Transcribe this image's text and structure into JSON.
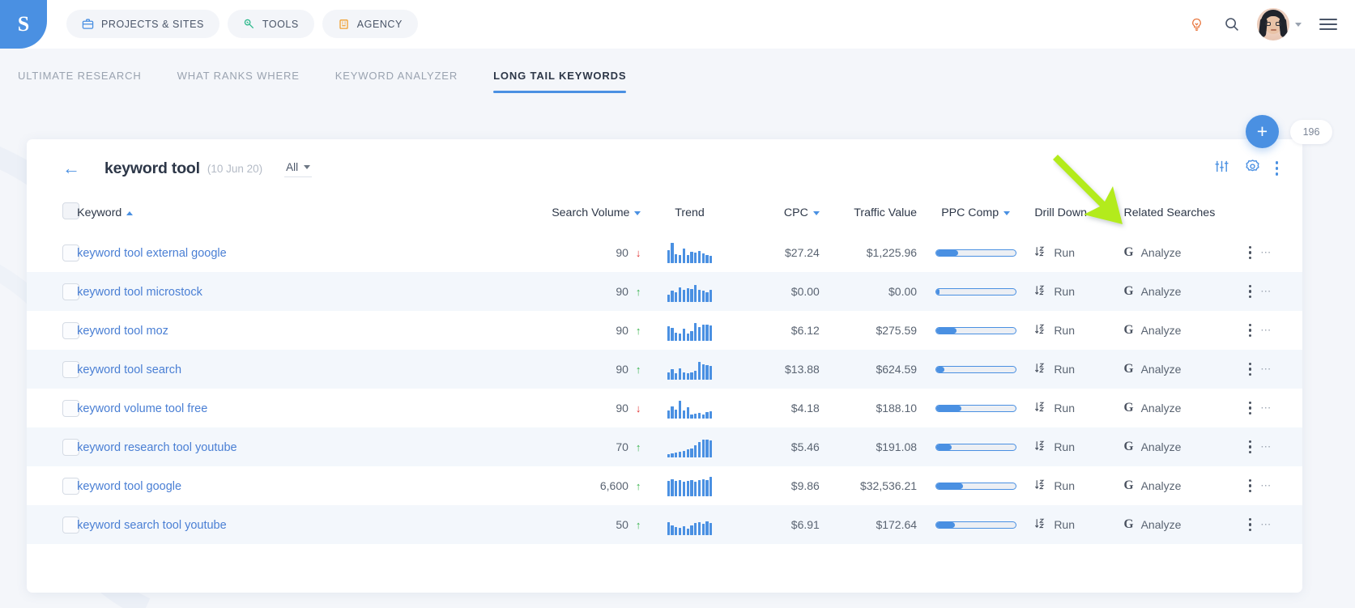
{
  "brand": {
    "logo_glyph": "S",
    "accent": "#4a90e2"
  },
  "topnav": {
    "pills": [
      {
        "label": "PROJECTS & SITES",
        "icon": "briefcase-icon",
        "color": "#4a90e2"
      },
      {
        "label": "TOOLS",
        "icon": "wrench-icon",
        "color": "#2fb98d"
      },
      {
        "label": "AGENCY",
        "icon": "building-icon",
        "color": "#f0a030"
      }
    ],
    "icons": [
      {
        "name": "lightbulb-icon",
        "color": "#e8743b"
      },
      {
        "name": "search-icon",
        "color": "#4a5568"
      }
    ],
    "avatar_alt": "user-avatar",
    "menu_icon": "hamburger-menu-icon"
  },
  "tabs": [
    {
      "label": "ULTIMATE RESEARCH",
      "active": false
    },
    {
      "label": "WHAT RANKS WHERE",
      "active": false
    },
    {
      "label": "KEYWORD ANALYZER",
      "active": false
    },
    {
      "label": "LONG TAIL KEYWORDS",
      "active": true
    }
  ],
  "fab": {
    "plus_label": "+",
    "count_label": "196"
  },
  "card": {
    "back_icon": "back-arrow-icon",
    "title": "keyword tool",
    "date": "(10 Jun 20)",
    "filter_select": "All",
    "head_icons": [
      {
        "name": "sliders-filter-icon"
      },
      {
        "name": "gear-settings-icon"
      },
      {
        "name": "more-vertical-icon"
      }
    ]
  },
  "table": {
    "columns": [
      {
        "key": "checkbox",
        "label": "",
        "sort": null
      },
      {
        "key": "keyword",
        "label": "Keyword",
        "sort": "asc"
      },
      {
        "key": "search_volume",
        "label": "Search Volume",
        "sort": "desc"
      },
      {
        "key": "trend",
        "label": "Trend",
        "sort": null
      },
      {
        "key": "cpc",
        "label": "CPC",
        "sort": "desc"
      },
      {
        "key": "traffic_value",
        "label": "Traffic Value",
        "sort": null
      },
      {
        "key": "ppc_comp",
        "label": "PPC Comp",
        "sort": "desc"
      },
      {
        "key": "drill_down",
        "label": "Drill Down",
        "sort": null
      },
      {
        "key": "related_searches",
        "label": "Related Searches",
        "sort": null
      },
      {
        "key": "actions",
        "label": "",
        "sort": null
      }
    ],
    "action_labels": {
      "drill_down": "Run",
      "related": "Analyze",
      "google_mark": "G"
    },
    "rows": [
      {
        "keyword": "keyword tool external google",
        "search_volume": "90",
        "trend_dir": "down",
        "sparkline": [
          62,
          96,
          44,
          38,
          70,
          40,
          52,
          50,
          56,
          48,
          40,
          36
        ],
        "cpc": "$27.24",
        "traffic_value": "$1,225.96",
        "ppc_comp": 28,
        "drill_down": "Run",
        "related": "Analyze"
      },
      {
        "keyword": "keyword tool microstock",
        "search_volume": "90",
        "trend_dir": "up",
        "sparkline": [
          34,
          52,
          48,
          70,
          58,
          66,
          62,
          82,
          58,
          54,
          46,
          56
        ],
        "cpc": "$0.00",
        "traffic_value": "$0.00",
        "ppc_comp": 4,
        "drill_down": "Run",
        "related": "Analyze"
      },
      {
        "keyword": "keyword tool moz",
        "search_volume": "90",
        "trend_dir": "up",
        "sparkline": [
          70,
          62,
          40,
          34,
          58,
          36,
          48,
          86,
          66,
          76,
          78,
          72
        ],
        "cpc": "$6.12",
        "traffic_value": "$275.59",
        "ppc_comp": 26,
        "drill_down": "Run",
        "related": "Analyze"
      },
      {
        "keyword": "keyword tool search",
        "search_volume": "90",
        "trend_dir": "up",
        "sparkline": [
          36,
          50,
          30,
          54,
          36,
          30,
          34,
          44,
          84,
          74,
          70,
          66
        ],
        "cpc": "$13.88",
        "traffic_value": "$624.59",
        "ppc_comp": 11,
        "drill_down": "Run",
        "related": "Analyze"
      },
      {
        "keyword": "keyword volume tool free",
        "search_volume": "90",
        "trend_dir": "down",
        "sparkline": [
          40,
          58,
          44,
          86,
          40,
          52,
          18,
          22,
          26,
          18,
          30,
          34
        ],
        "cpc": "$4.18",
        "traffic_value": "$188.10",
        "ppc_comp": 32,
        "drill_down": "Run",
        "related": "Analyze"
      },
      {
        "keyword": "keyword research tool youtube",
        "search_volume": "70",
        "trend_dir": "up",
        "sparkline": [
          16,
          20,
          24,
          28,
          30,
          38,
          44,
          56,
          74,
          84,
          86,
          80
        ],
        "cpc": "$5.46",
        "traffic_value": "$191.08",
        "ppc_comp": 20,
        "drill_down": "Run",
        "related": "Analyze"
      },
      {
        "keyword": "keyword tool google",
        "search_volume": "6,600",
        "trend_dir": "up",
        "sparkline": [
          74,
          80,
          72,
          76,
          68,
          72,
          78,
          70,
          76,
          82,
          78,
          92
        ],
        "cpc": "$9.86",
        "traffic_value": "$32,536.21",
        "ppc_comp": 34,
        "drill_down": "Run",
        "related": "Analyze"
      },
      {
        "keyword": "keyword search tool youtube",
        "search_volume": "50",
        "trend_dir": "up",
        "sparkline": [
          60,
          46,
          38,
          34,
          44,
          30,
          48,
          56,
          62,
          52,
          66,
          58
        ],
        "cpc": "$6.91",
        "traffic_value": "$172.64",
        "ppc_comp": 24,
        "drill_down": "Run",
        "related": "Analyze"
      }
    ]
  },
  "annotation": {
    "type": "arrow",
    "color": "#b3eb1f",
    "points_to": "Drill Down"
  }
}
